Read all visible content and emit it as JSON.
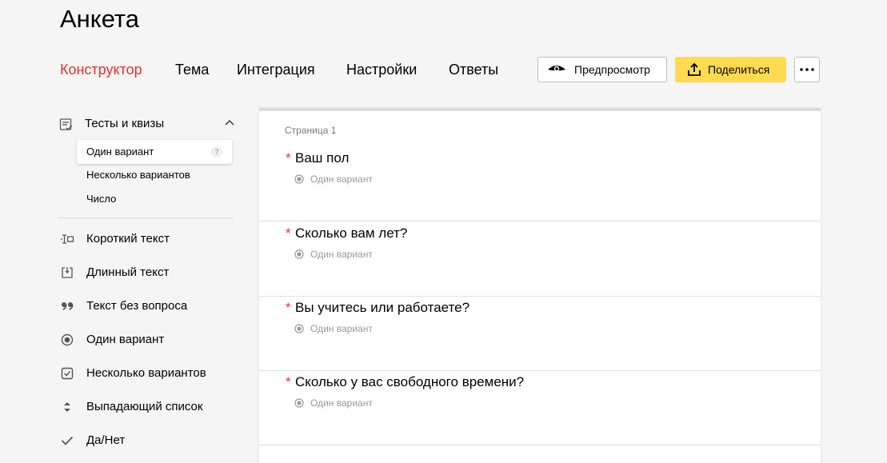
{
  "title": "Анкета",
  "tabs": [
    {
      "label": "Конструктор",
      "active": true
    },
    {
      "label": "Тема",
      "active": false
    },
    {
      "label": "Интеграция",
      "active": false
    },
    {
      "label": "Настройки",
      "active": false
    },
    {
      "label": "Ответы",
      "active": false
    }
  ],
  "toolbar": {
    "preview_label": "Предпросмотр",
    "preview_icon": "eye-icon",
    "share_label": "Поделиться",
    "share_icon": "upload-icon",
    "more_icon": "more-dots-icon"
  },
  "sidebar": {
    "group": {
      "label": "Тесты и квизы",
      "icon": "quiz-icon",
      "expanded": true,
      "items": [
        {
          "label": "Один вариант",
          "selected": true,
          "help_label": "?"
        },
        {
          "label": "Несколько вариантов",
          "selected": false
        },
        {
          "label": "Число",
          "selected": false
        }
      ]
    },
    "items": [
      {
        "label": "Короткий текст",
        "icon": "short-text-icon"
      },
      {
        "label": "Длинный текст",
        "icon": "long-text-icon"
      },
      {
        "label": "Текст без вопроса",
        "icon": "quote-icon"
      },
      {
        "label": "Один вариант",
        "icon": "radio-icon"
      },
      {
        "label": "Несколько вариантов",
        "icon": "checkbox-icon"
      },
      {
        "label": "Выпадающий список",
        "icon": "sort-arrows-icon"
      },
      {
        "label": "Да/Нет",
        "icon": "check-icon"
      }
    ]
  },
  "form": {
    "page_label": "Страница 1",
    "questions": [
      {
        "required_mark": "*",
        "title": "Ваш пол",
        "type": "Один вариант"
      },
      {
        "required_mark": "*",
        "title": "Сколько вам лет?",
        "type": "Один вариант"
      },
      {
        "required_mark": "*",
        "title": "Вы учитесь или работаете?",
        "type": "Один вариант"
      },
      {
        "required_mark": "*",
        "title": "Сколько у вас свободного времени?",
        "type": "Один вариант"
      }
    ]
  },
  "colors": {
    "accent_red": "#e8312d",
    "share_yellow": "#ffdb4d",
    "background": "#f5f5f5"
  }
}
